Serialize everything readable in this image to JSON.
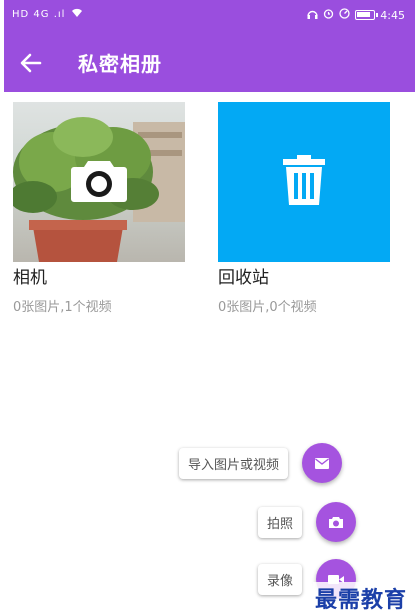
{
  "statusbar": {
    "left": "HD 4G .ıl",
    "time": "4:45"
  },
  "toolbar": {
    "title": "私密相册"
  },
  "albums": [
    {
      "name": "相机",
      "count": "0张图片,1个视频",
      "thumb": "photo-with-camera-icon"
    },
    {
      "name": "回收站",
      "count": "0张图片,0个视频",
      "thumb": "trash-icon",
      "color": "#03a9f4"
    }
  ],
  "fab_menu": [
    {
      "label": "导入图片或视频",
      "icon": "mail-icon"
    },
    {
      "label": "拍照",
      "icon": "camera-icon"
    },
    {
      "label": "录像",
      "icon": "video-icon"
    }
  ],
  "watermark": "最需教育",
  "colors": {
    "primary": "#9a4ede",
    "fab": "#a553df",
    "trash_bg": "#03a9f4"
  }
}
